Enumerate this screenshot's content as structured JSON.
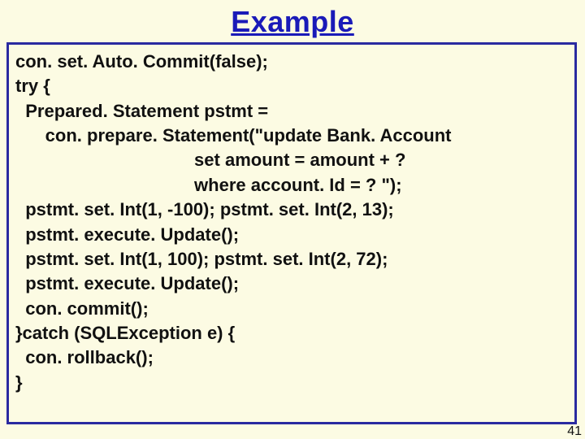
{
  "title": "Example",
  "page_number": "41",
  "code_lines": [
    "con. set. Auto. Commit(false);",
    "try {",
    "  Prepared. Statement pstmt =",
    "      con. prepare. Statement(\"update Bank. Account",
    "                                    set amount = amount + ?",
    "                                    where account. Id = ? \");",
    "  pstmt. set. Int(1, -100); pstmt. set. Int(2, 13);",
    "  pstmt. execute. Update();",
    "  pstmt. set. Int(1, 100); pstmt. set. Int(2, 72);",
    "  pstmt. execute. Update();",
    "  con. commit();",
    "}catch (SQLException e) {",
    "  con. rollback();",
    "}"
  ]
}
